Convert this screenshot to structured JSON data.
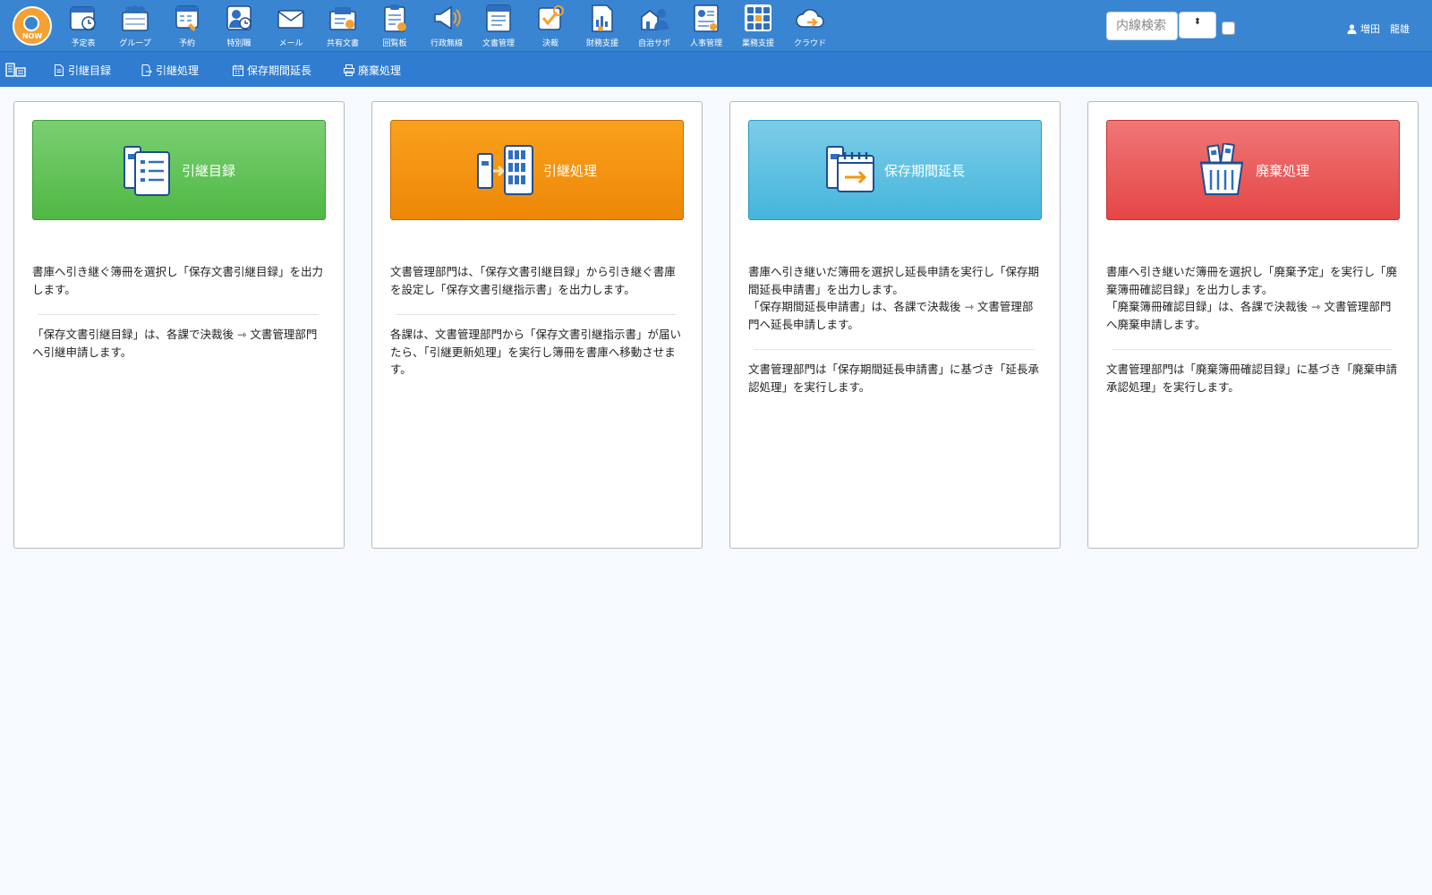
{
  "header": {
    "logo_text": "NOW",
    "apps": [
      {
        "label": "予定表",
        "icon": "calendar-clock-icon"
      },
      {
        "label": "グループ",
        "icon": "group-calendar-icon"
      },
      {
        "label": "予約",
        "icon": "reservation-icon"
      },
      {
        "label": "特別職",
        "icon": "executive-schedule-icon"
      },
      {
        "label": "メール",
        "icon": "mail-icon"
      },
      {
        "label": "共有文書",
        "icon": "shared-documents-icon"
      },
      {
        "label": "回覧板",
        "icon": "circular-board-icon"
      },
      {
        "label": "行政無線",
        "icon": "megaphone-icon"
      },
      {
        "label": "文書管理",
        "icon": "document-management-icon"
      },
      {
        "label": "決裁",
        "icon": "approval-check-icon"
      },
      {
        "label": "財務支援",
        "icon": "finance-report-icon"
      },
      {
        "label": "自治サポ",
        "icon": "municipal-support-icon"
      },
      {
        "label": "人事管理",
        "icon": "personnel-management-icon"
      },
      {
        "label": "業務支援",
        "icon": "business-support-grid-icon"
      },
      {
        "label": "クラウド",
        "icon": "cloud-icon"
      }
    ],
    "search": {
      "placeholder": "内線検索",
      "value": ""
    },
    "select_arrows": "⬍",
    "user_name": "増田　龍雄"
  },
  "subnav": {
    "items": [
      {
        "label": "引継目録",
        "icon": "document-icon"
      },
      {
        "label": "引継処理",
        "icon": "transfer-icon"
      },
      {
        "label": "保存期間延長",
        "icon": "calendar-icon"
      },
      {
        "label": "廃棄処理",
        "icon": "printer-icon"
      }
    ]
  },
  "cards": [
    {
      "title": "引継目録",
      "color": "#5cc152",
      "icon": "list-document-icon",
      "paragraphs": [
        "書庫へ引き継ぐ簿冊を選択し「保存文書引継目録」を出力します。"
      ],
      "paragraphs2": [
        "「保存文書引継目録」は、各課で決裁後 ⇾ 文書管理部門へ引継申請します。"
      ]
    },
    {
      "title": "引継処理",
      "color": "#f39512",
      "icon": "transfer-to-shelf-icon",
      "paragraphs": [
        "文書管理部門は、「保存文書引継目録」から引き継ぐ書庫を設定し「保存文書引継指示書」を出力します。"
      ],
      "paragraphs2": [
        "各課は、文書管理部門から「保存文書引継指示書」が届いたら、「引継更新処理」を実行し簿冊を書庫へ移動させます。"
      ]
    },
    {
      "title": "保存期間延長",
      "color": "#5cc1e2",
      "icon": "calendar-extend-icon",
      "paragraphs": [
        "書庫へ引き継いだ簿冊を選択し延長申請を実行し「保存期間延長申請書」を出力します。",
        "「保存期間延長申請書」は、各課で決裁後 ⇾ 文書管理部門へ延長申請します。"
      ],
      "paragraphs2": [
        "文書管理部門は「保存期間延長申請書」に基づき「延長承認処理」を実行します。"
      ]
    },
    {
      "title": "廃棄処理",
      "color": "#ea5858",
      "icon": "disposal-basket-icon",
      "paragraphs": [
        "書庫へ引き継いだ簿冊を選択し「廃棄予定」を実行し「廃棄簿冊確認目録」を出力します。",
        "「廃棄簿冊確認目録」は、各課で決裁後 ⇾ 文書管理部門へ廃棄申請します。"
      ],
      "paragraphs2": [
        "文書管理部門は「廃棄簿冊確認目録」に基づき「廃棄申請承認処理」を実行します。"
      ]
    }
  ]
}
